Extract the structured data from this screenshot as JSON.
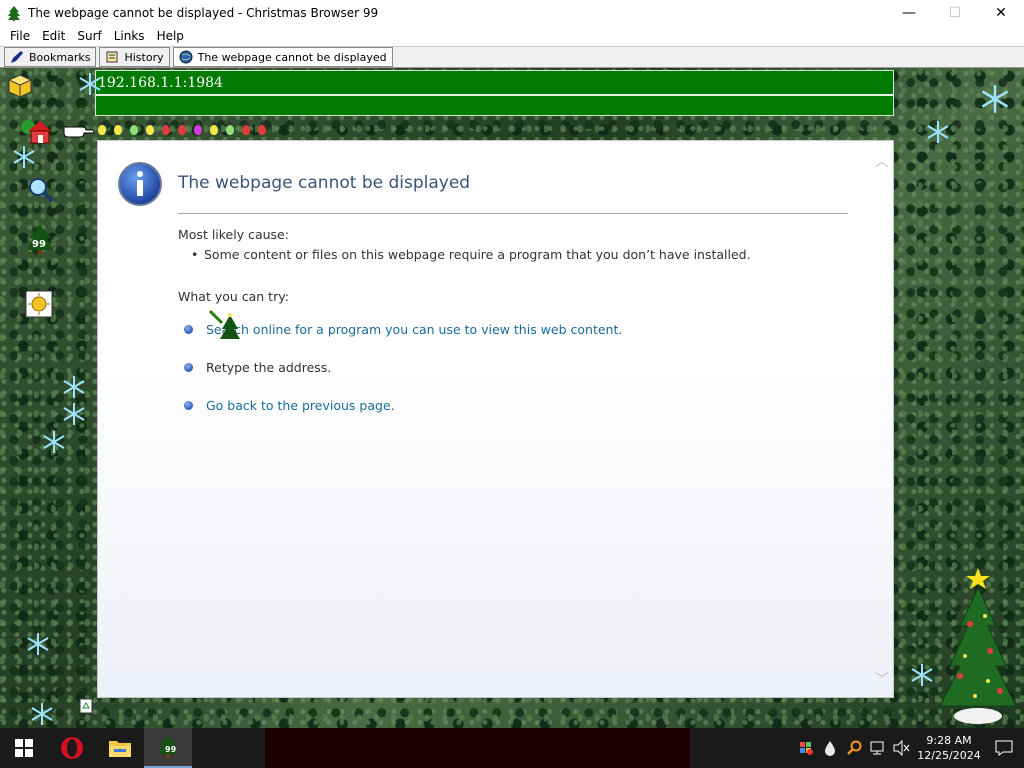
{
  "window": {
    "title": "The webpage cannot be displayed - Christmas Browser 99",
    "controls": {
      "minimize": "—",
      "maximize": "☐",
      "close": "✕"
    }
  },
  "menubar": {
    "items": [
      "File",
      "Edit",
      "Surf",
      "Links",
      "Help"
    ]
  },
  "tabs": [
    {
      "label": "Bookmarks",
      "icon": "pen-icon"
    },
    {
      "label": "History",
      "icon": "scroll-icon"
    },
    {
      "label": "The webpage cannot be displayed",
      "icon": "globe-icon"
    }
  ],
  "address_bar": {
    "value": "192.168.1.1:1984"
  },
  "toolbar": {
    "icons": [
      "cube-icon",
      "home-icon",
      "search-icon",
      "tree-99-icon",
      "sun-icon"
    ],
    "tree_badge": "99"
  },
  "lights": {
    "colors": [
      "#f5e84c",
      "#f5e84c",
      "#8fe07a",
      "#f5e84c",
      "#e03c3c",
      "#e03c3c",
      "#d23cd6",
      "#f5e84c",
      "#8fe07a",
      "#e03c3c",
      "#e03c3c"
    ]
  },
  "error_page": {
    "title": "The webpage cannot be displayed",
    "cause_heading": "Most likely cause:",
    "cause_item": "Some content or files on this webpage require a program that you don’t have installed.",
    "try_heading": "What you can try:",
    "try_items": [
      {
        "text": "Search online for a program you can use to view this web content.",
        "is_link": true
      },
      {
        "text": "Retype the address.",
        "is_link": false
      },
      {
        "text": "Go back to the previous page.",
        "is_link": true
      }
    ]
  },
  "colors": {
    "address_bar_bg": "#007a00",
    "error_title": "#37557a",
    "link": "#1a6b9c",
    "taskbar": "#1a1a1a"
  },
  "taskbar": {
    "apps": [
      "windows-start-icon",
      "opera-icon",
      "file-explorer-icon",
      "christmas-browser-icon"
    ],
    "app_badge": "99",
    "tray_icons": [
      "network-warning-icon",
      "drop-icon",
      "search-icon",
      "network-icon",
      "volume-muted-icon"
    ],
    "time": "9:28 AM",
    "date": "12/25/2024"
  }
}
